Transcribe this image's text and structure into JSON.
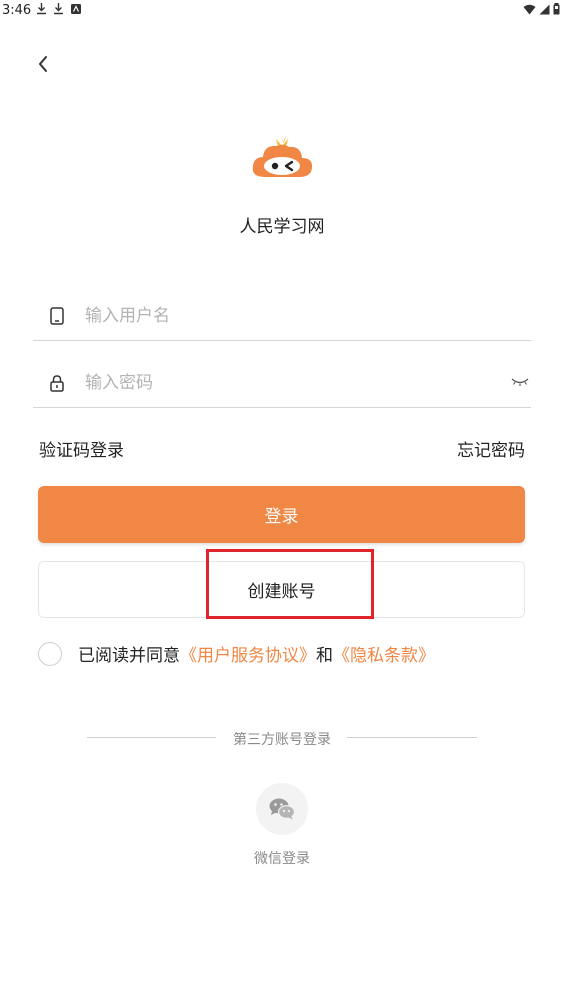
{
  "status_bar": {
    "time": "3:46"
  },
  "app": {
    "name": "人民学习网"
  },
  "form": {
    "username_placeholder": "输入用户名",
    "password_placeholder": "输入密码"
  },
  "links": {
    "code_login": "验证码登录",
    "forgot_password": "忘记密码"
  },
  "buttons": {
    "login": "登录",
    "create_account": "创建账号"
  },
  "agreement": {
    "prefix": "已阅读并同意",
    "user_agreement": "《用户服务协议》",
    "and": "和",
    "privacy": "《隐私条款》"
  },
  "third_party": {
    "heading": "第三方账号登录",
    "wechat_label": "微信登录"
  },
  "colors": {
    "accent": "#f08744",
    "highlight": "#e0242b"
  },
  "icons": [
    "download-icon",
    "download-icon",
    "notification-icon",
    "wifi-icon",
    "signal-icon",
    "battery-icon",
    "back-arrow-icon",
    "phone-icon",
    "lock-icon",
    "eye-closed-icon",
    "wechat-icon"
  ]
}
